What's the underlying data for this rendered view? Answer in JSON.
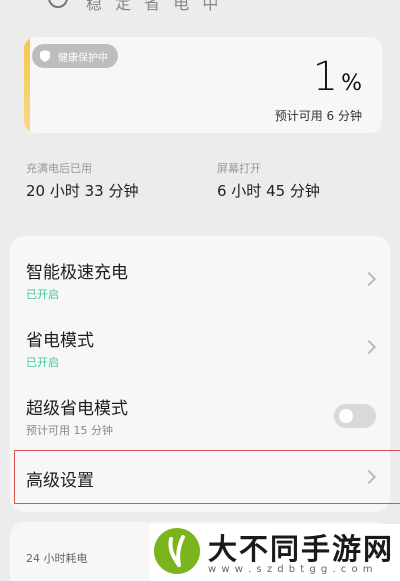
{
  "top": {
    "partial_text": "稳 定 省 电 中"
  },
  "battery": {
    "badge": "健康保护中",
    "percent": "1",
    "unit": "%",
    "estimate": "预计可用 6 分钟"
  },
  "stats": {
    "since_full": {
      "label": "充满电后已用",
      "value": "20 小时 33 分钟"
    },
    "screen_on": {
      "label": "屏幕打开",
      "value": "6 小时 45 分钟"
    }
  },
  "settings": {
    "smart_charge": {
      "title": "智能极速充电",
      "status": "已开启"
    },
    "power_saving": {
      "title": "省电模式",
      "status": "已开启"
    },
    "super_saving": {
      "title": "超级省电模式",
      "status": "预计可用 15 分钟",
      "enabled": false
    },
    "advanced": {
      "title": "高级设置"
    }
  },
  "bottom": {
    "label": "24 小时耗电"
  },
  "watermark": {
    "name": "大不同手游网",
    "url": "w w w . s z d b t g g . c o m"
  },
  "colors": {
    "accent_green": "#3ec9a4",
    "battery_bar": "#f7c64a",
    "highlight": "#d9534f"
  }
}
